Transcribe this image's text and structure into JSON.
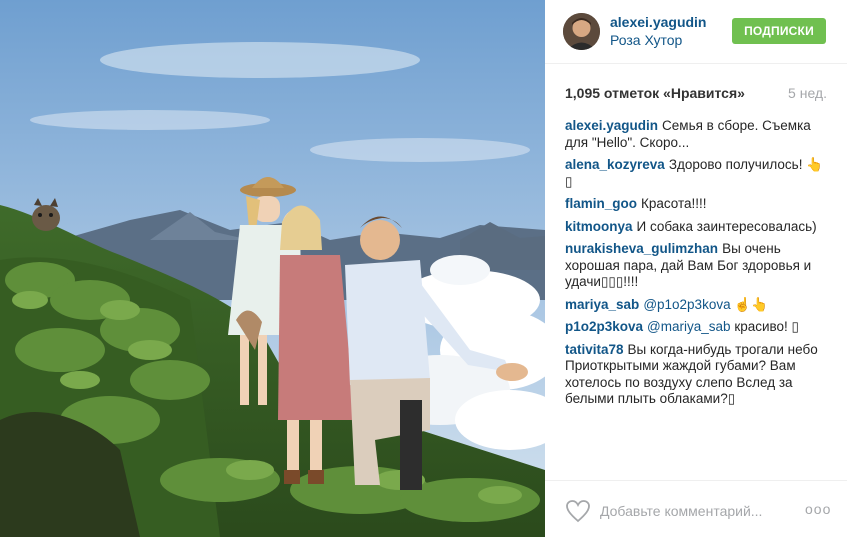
{
  "post": {
    "username": "alexei.yagudin",
    "location": "Роза Хутор",
    "follow_label": "ПОДПИСКИ",
    "likes": "1,095 отметок «Нравится»",
    "age": "5 нед.",
    "add_comment_placeholder": "Добавьте комментарий...",
    "more_label": "ooo"
  },
  "comments": [
    {
      "user": "alexei.yagudin",
      "text": "Семья в сборе. Съемка для \"Hello\". Скоро..."
    },
    {
      "user": "alena_kozyreva",
      "text": "Здорово получилось! 👆▯"
    },
    {
      "user": "flamin_goo",
      "text": "Красота!!!!"
    },
    {
      "user": "kitmoonya",
      "text": "И собака заинтересовалась)"
    },
    {
      "user": "nurakisheva_gulimzhan",
      "text": "Вы очень хорошая пара, дай Вам Бог здоровья и удачи▯▯▯!!!!"
    },
    {
      "user": "mariya_sab",
      "mention": "@p1o2p3kova",
      "text": "☝👆"
    },
    {
      "user": "p1o2p3kova",
      "mention": "@mariya_sab",
      "text": "красиво! ▯"
    },
    {
      "user": "tativita78",
      "text": "Вы когда-нибудь трогали небо Приоткрытыми жаждой губами? Вам хотелось по воздуху слепо Вслед за белыми плыть облаками?▯"
    }
  ],
  "colors": {
    "accent": "#125688",
    "follow": "#70c050",
    "muted": "#a5a7aa"
  },
  "icons": [
    "heart-icon",
    "more-options-icon"
  ]
}
